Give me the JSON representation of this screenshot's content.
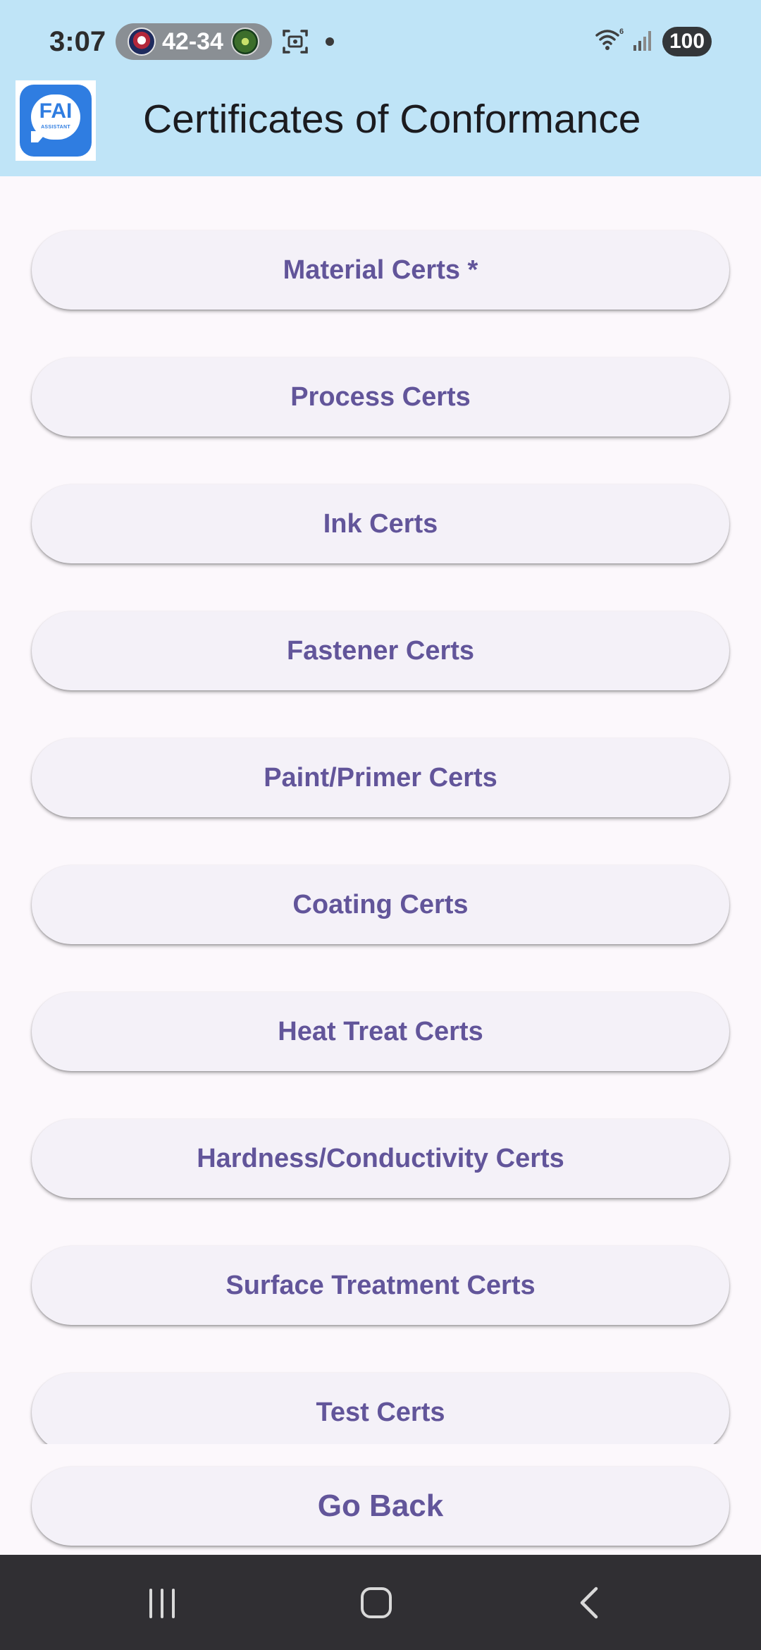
{
  "status_bar": {
    "time": "3:07",
    "score": "42-34",
    "battery": "100",
    "icons": [
      "team-logo",
      "team-logo",
      "screenshot-icon",
      "dot-icon",
      "wifi-icon",
      "signal-icon"
    ]
  },
  "app_bar": {
    "logo_text": "FAI",
    "logo_subtext": "ASSISTANT",
    "title": "Certificates of Conformance",
    "background_color": "#bfe4f7"
  },
  "cert_buttons": [
    {
      "label": "Material Certs *"
    },
    {
      "label": "Process Certs"
    },
    {
      "label": "Ink Certs"
    },
    {
      "label": "Fastener Certs"
    },
    {
      "label": "Paint/Primer Certs"
    },
    {
      "label": "Coating Certs"
    },
    {
      "label": "Heat Treat Certs"
    },
    {
      "label": "Hardness/Conductivity Certs"
    },
    {
      "label": "Surface Treatment Certs"
    },
    {
      "label": "Test Certs"
    }
  ],
  "footer": {
    "go_back_label": "Go Back"
  },
  "nav_bar": {
    "icons": [
      "recents-icon",
      "home-icon",
      "back-icon"
    ]
  },
  "colors": {
    "button_text": "#62559a",
    "button_background": "#f4f1f8",
    "page_background": "#fcf8fc",
    "nav_background": "#302f33"
  }
}
